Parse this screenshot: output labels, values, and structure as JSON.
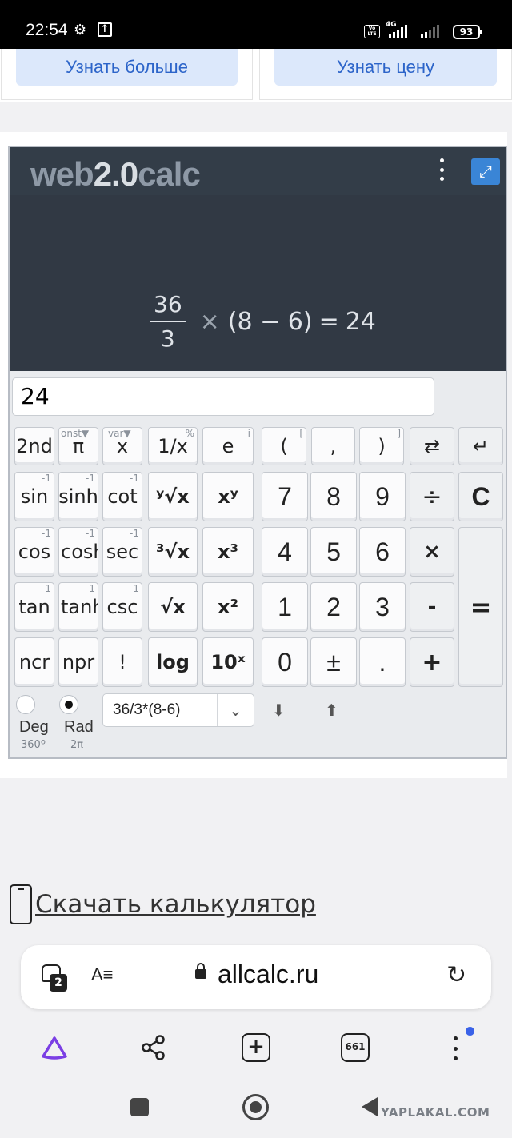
{
  "status_bar": {
    "time": "22:54",
    "network": "4G",
    "volte": "Vo LTE",
    "battery": "93",
    "icons": [
      "gear-icon",
      "upload-icon",
      "signal-icon",
      "battery-icon"
    ]
  },
  "ad_cards": [
    {
      "button_label": "Узнать больше"
    },
    {
      "button_label": "Узнать цену"
    }
  ],
  "calculator": {
    "logo_left": "web",
    "logo_mid": "2.0",
    "logo_right": "calc",
    "expression": {
      "numerator": "36",
      "denominator": "3",
      "times": "×",
      "group": "(8 − 6)",
      "equals": "=",
      "result": "24"
    },
    "input_value": "24",
    "keys": {
      "second": "2nd",
      "pi": "π",
      "pi_sup": "onst▼",
      "x": "x",
      "x_sup": "var▼",
      "inv": "1/x",
      "inv_sup": "%",
      "e": "e",
      "e_sup": "i",
      "lparen": "(",
      "lparen_sup": "[",
      "comma": ",",
      "rparen": ")",
      "rparen_sup": "]",
      "swap": "⇄",
      "back": "↵",
      "sin": "sin",
      "sinh": "sinh",
      "cot": "cot",
      "yroot": "ʸ√x",
      "xpow": "xʸ",
      "seven": "7",
      "eight": "8",
      "nine": "9",
      "div": "÷",
      "clear": "C",
      "cos": "cos",
      "cosh": "cosh",
      "sec": "sec",
      "cbrt": "³√x",
      "cube": "x³",
      "four": "4",
      "five": "5",
      "six": "6",
      "mul": "×",
      "tan": "tan",
      "tanh": "tanh",
      "csc": "csc",
      "sqrt": "√x",
      "square": "x²",
      "one": "1",
      "two": "2",
      "three": "3",
      "minus": "-",
      "equals": "=",
      "ncr": "ncr",
      "npr": "npr",
      "fact": "!",
      "log": "log",
      "tenx": "10ˣ",
      "zero": "0",
      "pm": "±",
      "dot": ".",
      "plus": "+",
      "inv_mark": "-1"
    },
    "mode": {
      "deg_label": "Deg",
      "deg_sub": "360º",
      "rad_label": "Rad",
      "rad_sub": "2π",
      "selected": "Rad"
    },
    "history_value": "36/3*(8-6)",
    "history_down": "⬇",
    "history_up": "⬆"
  },
  "download_link": "Скачать калькулятор",
  "browser": {
    "tab_count_badge": "2",
    "reader_icon": "A≡",
    "url": "allcalc.ru",
    "reload_icon": "↻",
    "toolbar": {
      "share_icon": "share-icon",
      "new_tab": "+",
      "tabs": "661"
    }
  },
  "watermark": "YAPLAKAL.COM"
}
